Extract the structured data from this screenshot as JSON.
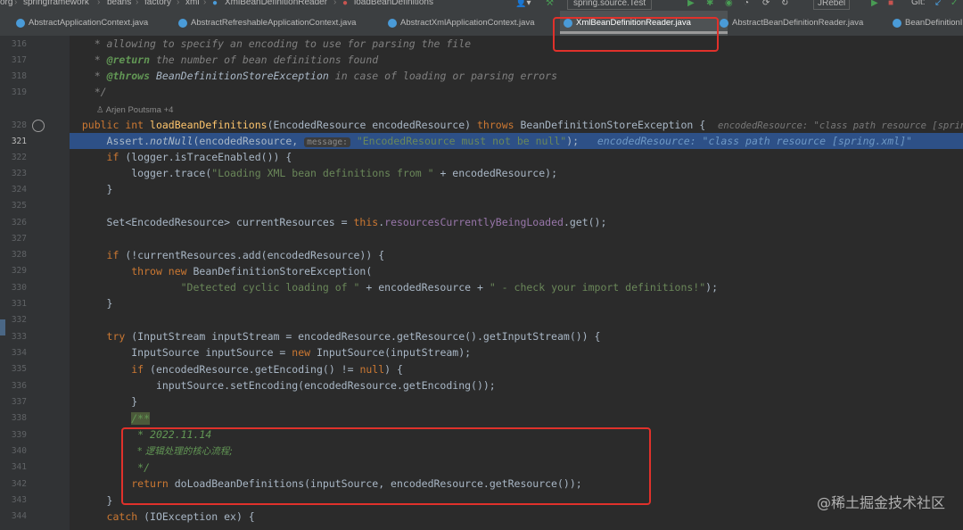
{
  "breadcrumb": [
    "org",
    "springframework",
    "beans",
    "factory",
    "xml",
    "XmlBeanDefinitionReader",
    "loadBeanDefinitions"
  ],
  "toolbar": {
    "run_config": "spring.source.Test",
    "jrebel": "JRebel",
    "git": "Git:"
  },
  "tabs": [
    {
      "label": "AbstractApplicationContext.java",
      "active": false
    },
    {
      "label": "AbstractRefreshableApplicationContext.java",
      "active": false
    },
    {
      "label": "AbstractXmlApplicationContext.java",
      "active": false
    },
    {
      "label": "XmlBeanDefinitionReader.java",
      "active": true
    },
    {
      "label": "AbstractBeanDefinitionReader.java",
      "active": false
    },
    {
      "label": "BeanDefinitionI",
      "active": false
    }
  ],
  "author": "Arjen Poutsma +4",
  "line_numbers": [
    "316",
    "317",
    "318",
    "319",
    "",
    "328",
    "321",
    "322",
    "323",
    "324",
    "325",
    "326",
    "327",
    "328",
    "329",
    "330",
    "331",
    "332",
    "333",
    "334",
    "335",
    "336",
    "337",
    "338",
    "339",
    "340",
    "341",
    "342",
    "343",
    "344"
  ],
  "code": {
    "l316": "* allowing to specify an encoding to use for parsing the file",
    "l317_tag": "@return",
    "l317_rest": " the number of bean definitions found",
    "l318_tag": "@throws",
    "l318_cls": "BeanDefinitionStoreException",
    "l318_rest": " in case of loading or parsing errors",
    "l319": "*/",
    "sig_mod": "public int ",
    "sig_fn": "loadBeanDefinitions",
    "sig_params": "(EncodedResource encodedResource) ",
    "sig_throws": "throws ",
    "sig_exc": "BeanDefinitionStoreException {",
    "sig_hint": "encodedResource: \"class path resource [spring.xml]\"",
    "assert_cls": "Assert.",
    "assert_fn": "notNull",
    "assert_arg": "(encodedResource, ",
    "assert_inlay": "message:",
    "assert_str": "\"EncodedResource must not be null\"",
    "assert_end": ");",
    "assert_hint": "encodedResource: \"class path resource [spring.xml]\"",
    "if_trace_kw": "if ",
    "if_trace_rest": "(logger.isTraceEnabled()) {",
    "trace_call": "logger.trace(",
    "trace_str": "\"Loading XML bean definitions from \"",
    "trace_end": " + encodedResource);",
    "close_brace": "}",
    "set_decl": "Set<EncodedResource> currentResources = ",
    "set_this": "this",
    "set_dot": ".",
    "set_field": "resourcesCurrentlyBeingLoaded",
    "set_end": ".get();",
    "if_add_kw": "if ",
    "if_add_rest": "(!currentResources.add(encodedResource)) {",
    "throw_kw": "throw new ",
    "throw_rest": "BeanDefinitionStoreException(",
    "cyc_str1": "\"Detected cyclic loading of \"",
    "cyc_mid": " + encodedResource + ",
    "cyc_str2": "\" - check your import definitions!\"",
    "cyc_end": ");",
    "try_kw": "try ",
    "try_rest": "(InputStream inputStream = encodedResource.getResource().getInputStream()) {",
    "is_decl": "InputSource inputSource = ",
    "is_new": "new ",
    "is_rest": "InputSource(inputStream);",
    "if_enc_kw": "if ",
    "if_enc_rest": "(encodedResource.getEncoding() != ",
    "null_kw": "null",
    "if_enc_end": ") {",
    "set_enc": "inputSource.setEncoding(encodedResource.getEncoding());",
    "doc_open": "/**",
    "doc_date": "* 2022.11.14",
    "doc_cn": "* 逻辑处理的核心流程;",
    "doc_close": "*/",
    "return_kw": "return ",
    "return_rest": "doLoadBeanDefinitions(inputSource, encodedResource.getResource());",
    "catch_kw": "catch ",
    "catch_rest": "(IOException ex) {"
  },
  "watermark": "@稀土掘金技术社区"
}
